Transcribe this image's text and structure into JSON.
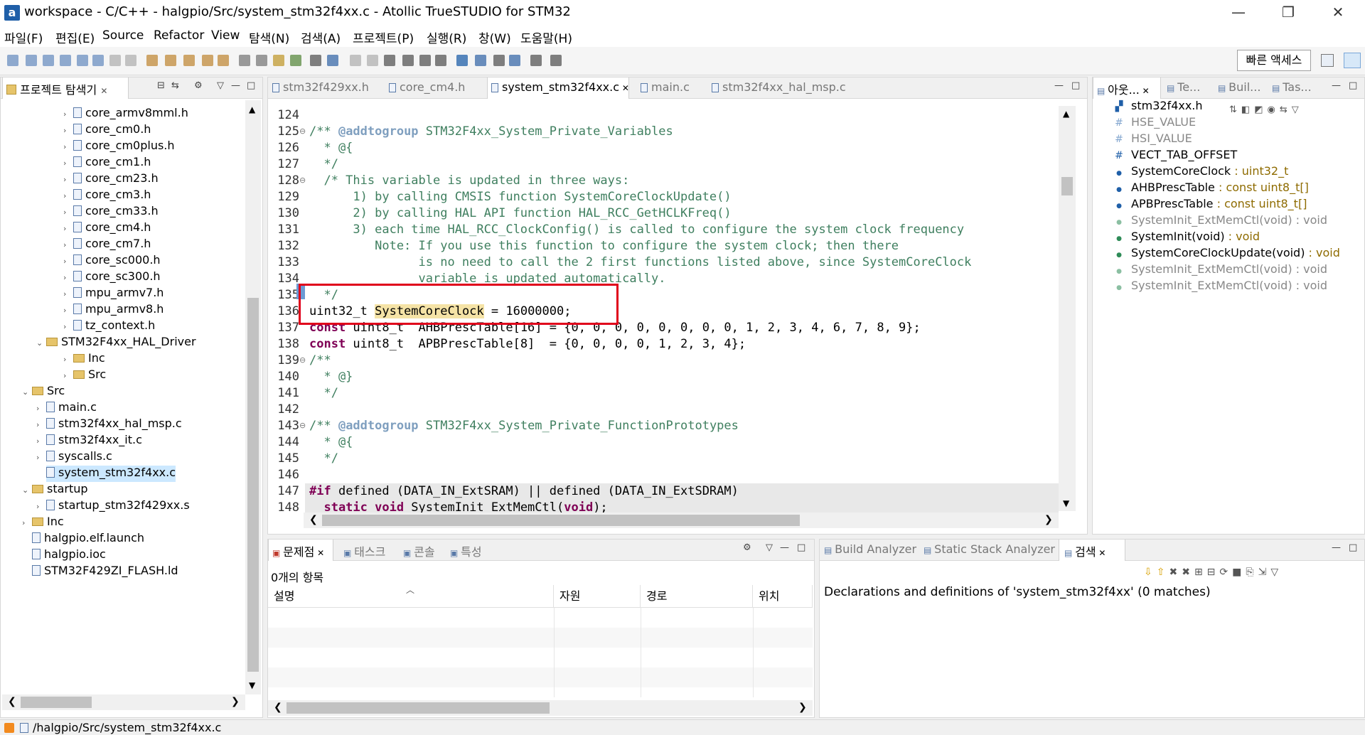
{
  "window": {
    "title": "workspace - C/C++ - halgpio/Src/system_stm32f4xx.c - Atollic TrueSTUDIO for STM32",
    "logo": "a",
    "minimize": "—",
    "restore": "❐",
    "close": "✕"
  },
  "menu": [
    "파일(F)",
    "편집(E)",
    "Source",
    "Refactor",
    "View",
    "탐색(N)",
    "검색(A)",
    "프로젝트(P)",
    "실행(R)",
    "창(W)",
    "도움말(H)"
  ],
  "quick_access": "빠른 액세스",
  "project_explorer": {
    "tab": "프로젝트 탐색기",
    "items": [
      {
        "label": "core_armv8mml.h",
        "type": "file",
        "depth": 2
      },
      {
        "label": "core_cm0.h",
        "type": "file",
        "depth": 2
      },
      {
        "label": "core_cm0plus.h",
        "type": "file",
        "depth": 2
      },
      {
        "label": "core_cm1.h",
        "type": "file",
        "depth": 2
      },
      {
        "label": "core_cm23.h",
        "type": "file",
        "depth": 2
      },
      {
        "label": "core_cm3.h",
        "type": "file",
        "depth": 2
      },
      {
        "label": "core_cm33.h",
        "type": "file",
        "depth": 2
      },
      {
        "label": "core_cm4.h",
        "type": "file",
        "depth": 2
      },
      {
        "label": "core_cm7.h",
        "type": "file",
        "depth": 2
      },
      {
        "label": "core_sc000.h",
        "type": "file",
        "depth": 2
      },
      {
        "label": "core_sc300.h",
        "type": "file",
        "depth": 2
      },
      {
        "label": "mpu_armv7.h",
        "type": "file",
        "depth": 2
      },
      {
        "label": "mpu_armv8.h",
        "type": "file",
        "depth": 2
      },
      {
        "label": "tz_context.h",
        "type": "file",
        "depth": 2
      },
      {
        "label": "STM32F4xx_HAL_Driver",
        "type": "folder-open",
        "depth": 1
      },
      {
        "label": "Inc",
        "type": "folder",
        "depth": 2
      },
      {
        "label": "Src",
        "type": "folder",
        "depth": 2
      },
      {
        "label": "Src",
        "type": "folder-open",
        "depth": 0
      },
      {
        "label": "main.c",
        "type": "file",
        "depth": 1
      },
      {
        "label": "stm32f4xx_hal_msp.c",
        "type": "file",
        "depth": 1
      },
      {
        "label": "stm32f4xx_it.c",
        "type": "file",
        "depth": 1
      },
      {
        "label": "syscalls.c",
        "type": "file",
        "depth": 1
      },
      {
        "label": "system_stm32f4xx.c",
        "type": "file",
        "depth": 1,
        "selected": true
      },
      {
        "label": "startup",
        "type": "folder-open",
        "depth": 0
      },
      {
        "label": "startup_stm32f429xx.s",
        "type": "file",
        "depth": 1
      },
      {
        "label": "Inc",
        "type": "folder",
        "depth": 0
      },
      {
        "label": "halgpio.elf.launch",
        "type": "file",
        "depth": 0,
        "leaf": true
      },
      {
        "label": "halgpio.ioc",
        "type": "file",
        "depth": 0,
        "leaf": true
      },
      {
        "label": "STM32F429ZI_FLASH.ld",
        "type": "file",
        "depth": 0,
        "leaf": true
      }
    ]
  },
  "editor": {
    "tabs": [
      "stm32f429xx.h",
      "core_cm4.h",
      "system_stm32f4xx.c",
      "main.c",
      "stm32f4xx_hal_msp.c"
    ],
    "active_tab": "system_stm32f4xx.c",
    "lines": [
      {
        "n": "124",
        "parts": [
          {
            "t": "",
            "c": ""
          }
        ]
      },
      {
        "n": "125",
        "fold": true,
        "parts": [
          {
            "t": "/** ",
            "c": "cmt"
          },
          {
            "t": "@addtogroup",
            "c": "tag"
          },
          {
            "t": " STM32F4xx_System_Private_Variables",
            "c": "cmt"
          }
        ]
      },
      {
        "n": "126",
        "parts": [
          {
            "t": "  * @{",
            "c": "cmt"
          }
        ]
      },
      {
        "n": "127",
        "parts": [
          {
            "t": "  */",
            "c": "cmt"
          }
        ]
      },
      {
        "n": "128",
        "fold": true,
        "parts": [
          {
            "t": "  /* This variable is updated in three ways:",
            "c": "cmt"
          }
        ]
      },
      {
        "n": "129",
        "parts": [
          {
            "t": "      1) by calling CMSIS function SystemCoreClockUpdate()",
            "c": "cmt"
          }
        ]
      },
      {
        "n": "130",
        "parts": [
          {
            "t": "      2) by calling HAL API function HAL_RCC_GetHCLKFreq()",
            "c": "cmt"
          }
        ]
      },
      {
        "n": "131",
        "parts": [
          {
            "t": "      3) each time HAL_RCC_ClockConfig() is called to configure the system clock frequency",
            "c": "cmt"
          }
        ]
      },
      {
        "n": "132",
        "parts": [
          {
            "t": "         Note: If you use this function to configure the system clock; then there",
            "c": "cmt"
          }
        ]
      },
      {
        "n": "133",
        "parts": [
          {
            "t": "               is no need to call the 2 first functions listed above, since SystemCoreClock",
            "c": "cmt"
          }
        ]
      },
      {
        "n": "134",
        "parts": [
          {
            "t": "               variable is updated automatically.",
            "c": "cmt"
          }
        ]
      },
      {
        "n": "135",
        "parts": [
          {
            "t": "  */",
            "c": "cmt"
          }
        ]
      },
      {
        "n": "136",
        "parts": [
          {
            "t": "uint32_t ",
            "c": ""
          },
          {
            "t": "SystemCoreClock",
            "c": "hl"
          },
          {
            "t": " = 16000000;",
            "c": ""
          }
        ]
      },
      {
        "n": "137",
        "parts": [
          {
            "t": "const",
            "c": "kw"
          },
          {
            "t": " uint8_t  AHBPrescTable[16] = {0, 0, 0, 0, 0, 0, 0, 0, 1, 2, 3, 4, 6, 7, 8, 9};",
            "c": ""
          }
        ]
      },
      {
        "n": "138",
        "parts": [
          {
            "t": "const",
            "c": "kw"
          },
          {
            "t": " uint8_t  APBPrescTable[8]  = {0, 0, 0, 0, 1, 2, 3, 4};",
            "c": ""
          }
        ]
      },
      {
        "n": "139",
        "fold": true,
        "parts": [
          {
            "t": "/**",
            "c": "cmt"
          }
        ]
      },
      {
        "n": "140",
        "parts": [
          {
            "t": "  * @}",
            "c": "cmt"
          }
        ]
      },
      {
        "n": "141",
        "parts": [
          {
            "t": "  */",
            "c": "cmt"
          }
        ]
      },
      {
        "n": "142",
        "parts": [
          {
            "t": "",
            "c": ""
          }
        ]
      },
      {
        "n": "143",
        "fold": true,
        "parts": [
          {
            "t": "/** ",
            "c": "cmt"
          },
          {
            "t": "@addtogroup",
            "c": "tag"
          },
          {
            "t": " STM32F4xx_System_Private_FunctionPrototypes",
            "c": "cmt"
          }
        ]
      },
      {
        "n": "144",
        "parts": [
          {
            "t": "  * @{",
            "c": "cmt"
          }
        ]
      },
      {
        "n": "145",
        "parts": [
          {
            "t": "  */",
            "c": "cmt"
          }
        ]
      },
      {
        "n": "146",
        "parts": [
          {
            "t": "",
            "c": ""
          }
        ]
      },
      {
        "n": "147",
        "shade": true,
        "parts": [
          {
            "t": "#if",
            "c": "pp"
          },
          {
            "t": " defined (DATA_IN_ExtSRAM) || defined (DATA_IN_ExtSDRAM)",
            "c": ""
          }
        ]
      },
      {
        "n": "148",
        "shade": true,
        "parts": [
          {
            "t": "  static void",
            "c": "kw"
          },
          {
            "t": " SystemInit_ExtMemCtl(",
            "c": ""
          },
          {
            "t": "void",
            "c": "kw"
          },
          {
            "t": ");",
            "c": ""
          }
        ]
      }
    ]
  },
  "outline": {
    "tabs": [
      "아웃...",
      "Te...",
      "Buil...",
      "Tas..."
    ],
    "items": [
      {
        "icon": "include",
        "name": "stm32f4xx.h",
        "type": ""
      },
      {
        "icon": "macro",
        "name": "HSE_VALUE",
        "type": "",
        "dim": true
      },
      {
        "icon": "macro",
        "name": "HSI_VALUE",
        "type": "",
        "dim": true
      },
      {
        "icon": "macro",
        "name": "VECT_TAB_OFFSET",
        "type": ""
      },
      {
        "icon": "var",
        "name": "SystemCoreClock",
        "type": " : uint32_t"
      },
      {
        "icon": "const-var",
        "name": "AHBPrescTable",
        "type": " : const uint8_t[]"
      },
      {
        "icon": "const-var",
        "name": "APBPrescTable",
        "type": " : const uint8_t[]"
      },
      {
        "icon": "static-fn",
        "name": "SystemInit_ExtMemCtl(void)",
        "type": " : void",
        "dim": true
      },
      {
        "icon": "fn",
        "name": "SystemInit(void)",
        "type": " : void"
      },
      {
        "icon": "fn",
        "name": "SystemCoreClockUpdate(void)",
        "type": " : void"
      },
      {
        "icon": "fn-dim",
        "name": "SystemInit_ExtMemCtl(void)",
        "type": " : void",
        "dim": true
      },
      {
        "icon": "fn-dim",
        "name": "SystemInit_ExtMemCtl(void)",
        "type": " : void",
        "dim": true
      }
    ]
  },
  "problems": {
    "tabs": [
      "문제점",
      "태스크",
      "콘솔",
      "특성"
    ],
    "count_text": "0개의 항목",
    "columns": [
      "설명",
      "자원",
      "경로",
      "위치"
    ]
  },
  "search": {
    "tabs": [
      "Build Analyzer",
      "Static Stack Analyzer",
      "검색"
    ],
    "result": "Declarations and definitions of 'system_stm32f4xx' (0 matches)"
  },
  "status": {
    "path": "/halgpio/Src/system_stm32f4xx.c"
  },
  "colors": {
    "highlight_box": "#e0001b",
    "selection": "#cce8ff"
  }
}
